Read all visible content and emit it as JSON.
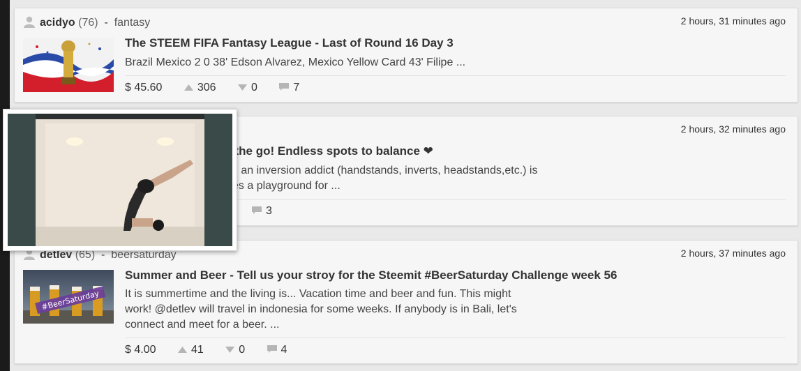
{
  "posts": [
    {
      "author": "acidyo",
      "reputation": "(76)",
      "separator": "-",
      "category": "fantasy",
      "time": "2 hours, 31 minutes ago",
      "title": "The STEEM FIFA Fantasy League - Last of Round 16 Day 3",
      "excerpt": "Brazil Mexico 2 0 38' Edson Alvarez, Mexico Yellow Card 43' Filipe ...",
      "payout": "$ 45.60",
      "upvotes": "306",
      "downvotes": "0",
      "comments": "7"
    },
    {
      "time": "2 hours, 32 minutes ago",
      "title": "on the go! Endless spots to balance ❤",
      "excerpt_line1": "g an inversion addict (handstands, inverts, headstands,etc.) is",
      "excerpt_line2": "es a playground for ...",
      "comments": "3"
    },
    {
      "author": "detlev",
      "reputation": "(65)",
      "separator": "-",
      "category": "beersaturday",
      "time": "2 hours, 37 minutes ago",
      "title": "Summer and Beer - Tell us your stroy for the Steemit #BeerSaturday Challenge week 56",
      "excerpt_line1": "It is summertime and the living is... Vacation time and beer and fun. This might",
      "excerpt_line2": "work! @detlev will travel in indonesia for some weeks. If anybody is in Bali, let's",
      "excerpt_line3": "connect and meet for a beer. ...",
      "payout": "$ 4.00",
      "upvotes": "41",
      "downvotes": "0",
      "comments": "4",
      "thumb_text": "#BeerSaturday"
    }
  ],
  "icons": {
    "user": "user-icon",
    "upvote": "upvote-icon",
    "downvote": "downvote-icon",
    "comment": "comment-icon"
  },
  "colors": {
    "background": "#e9e9e9",
    "card": "#f6f6f6",
    "text": "#333333",
    "icon_grey": "#b5b5b5"
  }
}
